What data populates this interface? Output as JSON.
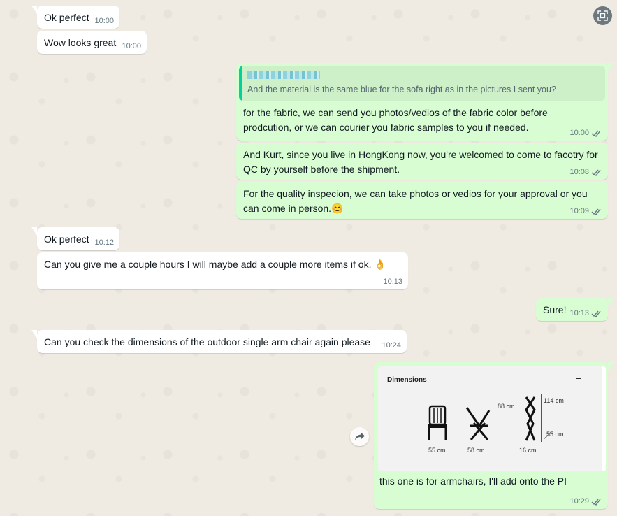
{
  "chat": {
    "messages": [
      {
        "id": "m1",
        "dir": "in",
        "text": "Ok perfect",
        "time": "10:00"
      },
      {
        "id": "m2",
        "dir": "in",
        "text": "Wow looks great",
        "time": "10:00"
      },
      {
        "id": "m3",
        "dir": "out",
        "quote": {
          "author": "",
          "text": "And the material is the same blue for the sofa right as in the pictures I sent you?"
        },
        "text": "for the fabric, we can send you photos/vedios of the fabric color before prodcution, or we can courier you fabric samples to you if needed.",
        "time": "10:00"
      },
      {
        "id": "m4",
        "dir": "out",
        "text": "And Kurt, since you live in HongKong now, you're welcomed to come to facotry for QC by yourself before the shipment.",
        "time": "10:08"
      },
      {
        "id": "m5",
        "dir": "out",
        "text": "For the quality inspecion, we can take photos or vedios for your approval or you can come in person.",
        "emoji": "😊",
        "time": "10:09"
      },
      {
        "id": "m6",
        "dir": "in",
        "text": "Ok perfect",
        "time": "10:12"
      },
      {
        "id": "m7",
        "dir": "in",
        "text": "Can you give me a couple hours I will maybe add a couple more items if ok.",
        "emoji": "👌",
        "time": "10:13"
      },
      {
        "id": "m8",
        "dir": "out",
        "text": "Sure!",
        "time": "10:13"
      },
      {
        "id": "m9",
        "dir": "in",
        "text": "Can you check the dimensions of the outdoor single arm chair again please",
        "time": "10:24"
      },
      {
        "id": "m10",
        "dir": "out",
        "image": {
          "title": "Dimensions",
          "minus": "−",
          "labels": {
            "w1": "55 cm",
            "w2": "58 cm",
            "h1": "88 cm",
            "h2": "114 cm",
            "d1": "16 cm",
            "d2": "55 cm"
          }
        },
        "text": "this one is for armchairs, I'll add onto the PI",
        "time": "10:29"
      }
    ]
  },
  "icons": {
    "read": "double-check-icon",
    "forward": "forward-icon",
    "top": "scan-icon"
  },
  "colors": {
    "incoming": "#ffffff",
    "outgoing": "#d9fdd3",
    "read_tick": "#667781",
    "quote_bar": "#06cf9c"
  }
}
